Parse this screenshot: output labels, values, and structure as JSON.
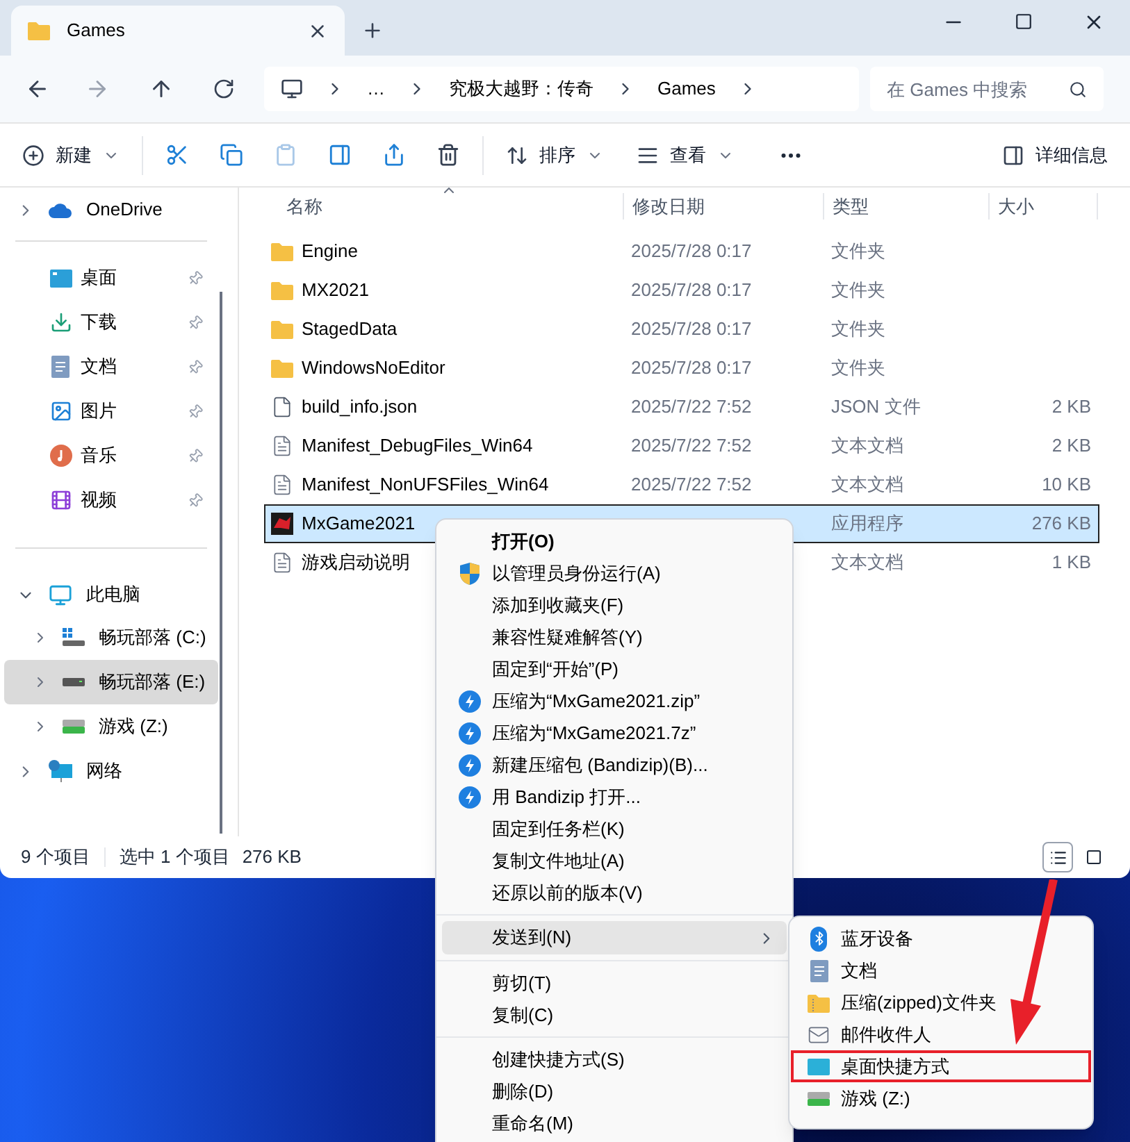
{
  "tab": {
    "title": "Games"
  },
  "address": {
    "parts": [
      "…",
      "究极大越野：传奇",
      "Games"
    ]
  },
  "search": {
    "placeholder": "在 Games 中搜索"
  },
  "toolbar": {
    "new": "新建",
    "sort": "排序",
    "view": "查看",
    "details": "详细信息"
  },
  "sidebar": {
    "onedrive": "OneDrive",
    "quick_access": [
      {
        "label": "桌面",
        "kind": "desktop"
      },
      {
        "label": "下载",
        "kind": "download"
      },
      {
        "label": "文档",
        "kind": "document"
      },
      {
        "label": "图片",
        "kind": "picture"
      },
      {
        "label": "音乐",
        "kind": "music"
      },
      {
        "label": "视频",
        "kind": "video"
      }
    ],
    "this_pc": {
      "label": "此电脑",
      "expanded": true,
      "children": [
        {
          "label": "畅玩部落 (C:)",
          "kind": "system",
          "selected": false
        },
        {
          "label": "畅玩部落 (E:)",
          "kind": "drive",
          "selected": true
        },
        {
          "label": "游戏 (Z:)",
          "kind": "netdrive",
          "selected": false
        }
      ]
    },
    "network": "网络"
  },
  "table": {
    "columns": [
      "名称",
      "修改日期",
      "类型",
      "大小"
    ],
    "rows": [
      {
        "name": "Engine",
        "kind": "folder",
        "date": "2025/7/28 0:17",
        "type": "文件夹",
        "selected": false
      },
      {
        "name": "MX2021",
        "kind": "folder",
        "date": "2025/7/28 0:17",
        "type": "文件夹",
        "selected": false
      },
      {
        "name": "StagedData",
        "kind": "folder",
        "date": "2025/7/28 0:17",
        "type": "文件夹",
        "selected": false
      },
      {
        "name": "WindowsNoEditor",
        "kind": "folder",
        "date": "2025/7/28 0:17",
        "type": "文件夹",
        "selected": false
      },
      {
        "name": "build_info.json",
        "kind": "file",
        "date": "2025/7/22 7:52",
        "type": "JSON 文件",
        "size": "2 KB",
        "selected": false
      },
      {
        "name": "Manifest_DebugFiles_Win64",
        "kind": "text",
        "date": "2025/7/22 7:52",
        "type": "文本文档",
        "size": "2 KB",
        "selected": false
      },
      {
        "name": "Manifest_NonUFSFiles_Win64",
        "kind": "text",
        "date": "2025/7/22 7:52",
        "type": "文本文档",
        "size": "10 KB",
        "selected": false
      },
      {
        "name": "MxGame2021",
        "kind": "app",
        "type": "应用程序",
        "size": "276 KB",
        "selected": true
      },
      {
        "name": "游戏启动说明",
        "kind": "text",
        "type": "文本文档",
        "size": "1 KB",
        "selected": false
      }
    ]
  },
  "status_bar": {
    "count": "9 个项目",
    "selection": "选中 1 个项目",
    "size": "276 KB"
  },
  "context_menu": {
    "groups": [
      [
        {
          "label": "打开(O)",
          "kind": "default"
        },
        {
          "label": "以管理员身份运行(A)",
          "kind": "shield"
        },
        {
          "label": "添加到收藏夹(F)",
          "kind": "plain"
        },
        {
          "label": "兼容性疑难解答(Y)",
          "kind": "plain"
        },
        {
          "label": "固定到“开始”(P)",
          "kind": "plain"
        },
        {
          "label": "压缩为“MxGame2021.zip”",
          "kind": "bandizip"
        },
        {
          "label": "压缩为“MxGame2021.7z”",
          "kind": "bandizip"
        },
        {
          "label": "新建压缩包 (Bandizip)(B)...",
          "kind": "bandizip"
        },
        {
          "label": "用 Bandizip 打开...",
          "kind": "bandizip"
        },
        {
          "label": "固定到任务栏(K)",
          "kind": "plain"
        },
        {
          "label": "复制文件地址(A)",
          "kind": "plain"
        },
        {
          "label": "还原以前的版本(V)",
          "kind": "plain"
        }
      ],
      [
        {
          "label": "发送到(N)",
          "kind": "submenu",
          "selected": true
        }
      ],
      [
        {
          "label": "剪切(T)",
          "kind": "plain"
        },
        {
          "label": "复制(C)",
          "kind": "plain"
        }
      ],
      [
        {
          "label": "创建快捷方式(S)",
          "kind": "plain"
        },
        {
          "label": "删除(D)",
          "kind": "plain"
        },
        {
          "label": "重命名(M)",
          "kind": "plain"
        }
      ]
    ]
  },
  "send_to_menu": [
    {
      "label": "蓝牙设备",
      "kind": "bluetooth",
      "highlighted": false
    },
    {
      "label": "文档",
      "kind": "document",
      "highlighted": false
    },
    {
      "label": "压缩(zipped)文件夹",
      "kind": "zip",
      "highlighted": false
    },
    {
      "label": "邮件收件人",
      "kind": "mail",
      "highlighted": false
    },
    {
      "label": "桌面快捷方式",
      "kind": "desktop",
      "highlighted": true
    },
    {
      "label": "游戏 (Z:)",
      "kind": "netdrive",
      "highlighted": false
    }
  ]
}
